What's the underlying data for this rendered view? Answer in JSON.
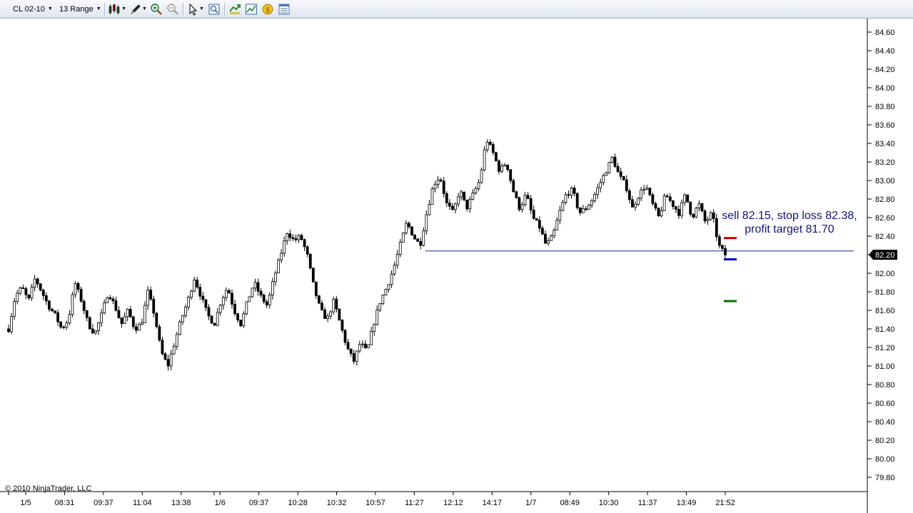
{
  "toolbar": {
    "instrument": "CL 02-10",
    "period": "13 Range",
    "icons": [
      "chart-style-icon",
      "drawing-tools-icon",
      "zoom-in-icon",
      "zoom-out-icon",
      "select-cursor-icon",
      "data-box-icon",
      "strategies-icon",
      "indicators-icon",
      "currency-icon",
      "properties-icon"
    ]
  },
  "copyright": "© 2010 NinjaTrader, LLC",
  "colors": {
    "candle_outline": "#000000",
    "down_fill": "#000000",
    "up_fill": "#ffffff",
    "horizontal_line": "#1e2a8a",
    "stop_marker": "#d40000",
    "entry_marker": "#0000c8",
    "target_marker": "#007000",
    "annotation": "#14147a"
  },
  "chart_data": {
    "type": "candlestick",
    "ylim": [
      79.7,
      84.7
    ],
    "yticks": [
      "79.80",
      "80.00",
      "80.20",
      "80.40",
      "80.60",
      "80.80",
      "81.00",
      "81.20",
      "81.40",
      "81.60",
      "81.80",
      "82.00",
      "82.20",
      "82.40",
      "82.60",
      "82.80",
      "83.00",
      "83.20",
      "83.40",
      "83.60",
      "83.80",
      "84.00",
      "84.20",
      "84.40",
      "84.60"
    ],
    "xticks": [
      "1/5",
      "08:31",
      "09:37",
      "11:04",
      "13:38",
      "1/6",
      "09:37",
      "10:28",
      "10:32",
      "10:57",
      "11:27",
      "12:12",
      "14:17",
      "1/7",
      "08:49",
      "10:30",
      "11:37",
      "13:49",
      "21:52"
    ],
    "price_path": [
      81.4,
      81.75,
      81.85,
      81.7,
      81.95,
      81.8,
      81.65,
      81.55,
      81.4,
      81.5,
      81.9,
      81.7,
      81.45,
      81.35,
      81.55,
      81.8,
      81.65,
      81.45,
      81.6,
      81.4,
      81.45,
      81.8,
      81.55,
      81.15,
      81.0,
      81.25,
      81.5,
      81.7,
      81.95,
      81.75,
      81.55,
      81.45,
      81.7,
      81.85,
      81.6,
      81.45,
      81.7,
      81.9,
      81.75,
      81.65,
      81.95,
      82.2,
      82.45,
      82.35,
      82.4,
      82.2,
      81.85,
      81.6,
      81.5,
      81.7,
      81.45,
      81.2,
      81.05,
      81.25,
      81.15,
      81.45,
      81.7,
      81.85,
      82.05,
      82.3,
      82.55,
      82.4,
      82.3,
      82.65,
      82.95,
      83.05,
      82.75,
      82.65,
      82.9,
      82.7,
      82.85,
      83.0,
      83.45,
      83.3,
      83.1,
      83.2,
      82.9,
      82.7,
      82.85,
      82.6,
      82.5,
      82.3,
      82.4,
      82.65,
      82.85,
      82.9,
      82.65,
      82.7,
      82.8,
      82.95,
      83.1,
      83.25,
      83.05,
      82.95,
      82.7,
      82.85,
      82.95,
      82.75,
      82.6,
      82.85,
      82.75,
      82.65,
      82.85,
      82.6,
      82.75,
      82.55,
      82.65,
      82.3,
      82.2
    ],
    "horizontal_line": {
      "price": 82.24
    },
    "last_price": "82.20",
    "markers": {
      "stop": 82.38,
      "entry": 82.15,
      "target": 81.7
    },
    "annotation": [
      "sell 82.15, stop loss 82.38,",
      "profit target 81.70"
    ]
  }
}
